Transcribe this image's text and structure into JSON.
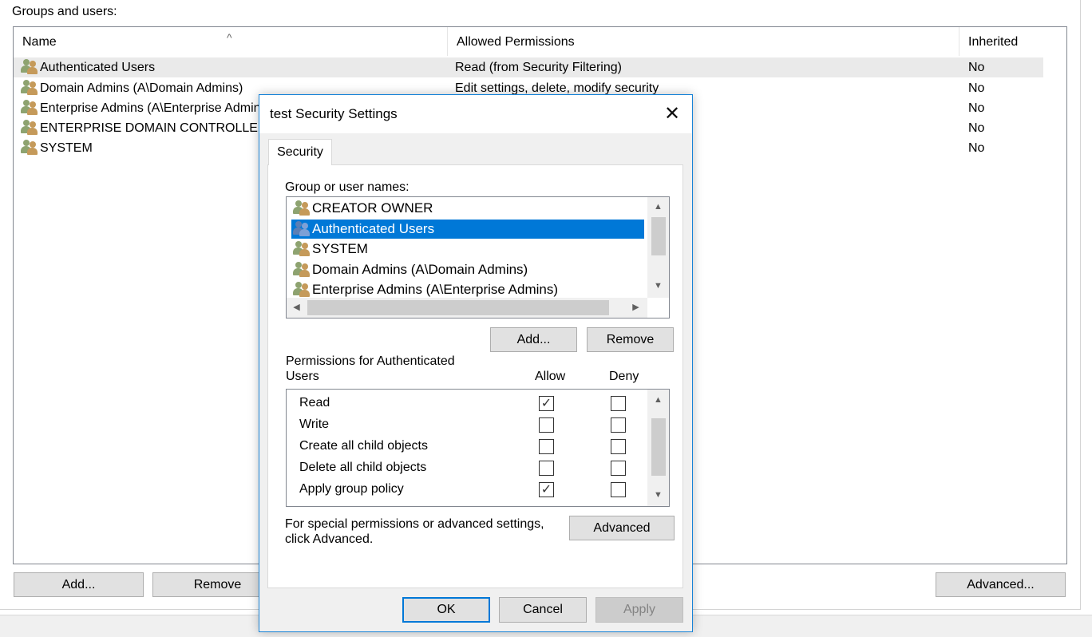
{
  "background": {
    "groups_label": "Groups and users:",
    "columns": [
      "Name",
      "Allowed Permissions",
      "Inherited"
    ],
    "sort_arrow": "^",
    "rows": [
      {
        "name": "Authenticated Users",
        "permissions": "Read (from Security Filtering)",
        "inherited": "No"
      },
      {
        "name": "Domain Admins (A\\Domain Admins)",
        "permissions": "Edit settings, delete, modify security",
        "inherited": "No"
      },
      {
        "name": "Enterprise Admins (A\\Enterprise Admins)",
        "permissions": "",
        "inherited": "No"
      },
      {
        "name": "ENTERPRISE DOMAIN CONTROLLERS",
        "permissions": "",
        "inherited": "No"
      },
      {
        "name": "SYSTEM",
        "permissions": "",
        "inherited": "No"
      }
    ],
    "add_label": "Add...",
    "remove_label": "Remove",
    "advanced_label": "Advanced..."
  },
  "dialog": {
    "title": "test Security Settings",
    "close_glyph": "✕",
    "tab_label": "Security",
    "group_names_label": "Group or user names:",
    "users": [
      {
        "name": "CREATOR OWNER",
        "selected": false
      },
      {
        "name": "Authenticated Users",
        "selected": true
      },
      {
        "name": "SYSTEM",
        "selected": false
      },
      {
        "name": "Domain Admins (A\\Domain Admins)",
        "selected": false
      },
      {
        "name": "Enterprise Admins (A\\Enterprise Admins)",
        "selected": false
      }
    ],
    "add_label": "Add...",
    "remove_label": "Remove",
    "permissions_label": "Permissions for Authenticated Users",
    "allow_label": "Allow",
    "deny_label": "Deny",
    "permissions": [
      {
        "name": "Read",
        "allow": true,
        "deny": false
      },
      {
        "name": "Write",
        "allow": false,
        "deny": false
      },
      {
        "name": "Create all child objects",
        "allow": false,
        "deny": false
      },
      {
        "name": "Delete all child objects",
        "allow": false,
        "deny": false
      },
      {
        "name": "Apply group policy",
        "allow": true,
        "deny": false
      }
    ],
    "special_text": "For special permissions or advanced settings, click Advanced.",
    "advanced_label": "Advanced",
    "ok_label": "OK",
    "cancel_label": "Cancel",
    "apply_label": "Apply"
  },
  "icons": {
    "user_group": "users-icon",
    "scroll_up": "▲",
    "scroll_down": "▼",
    "scroll_left": "◀",
    "scroll_right": "▶",
    "check": "✓"
  },
  "colors": {
    "selection": "#0078d7",
    "dialog_border": "#1883d7",
    "row_highlight": "#eaeaea"
  }
}
